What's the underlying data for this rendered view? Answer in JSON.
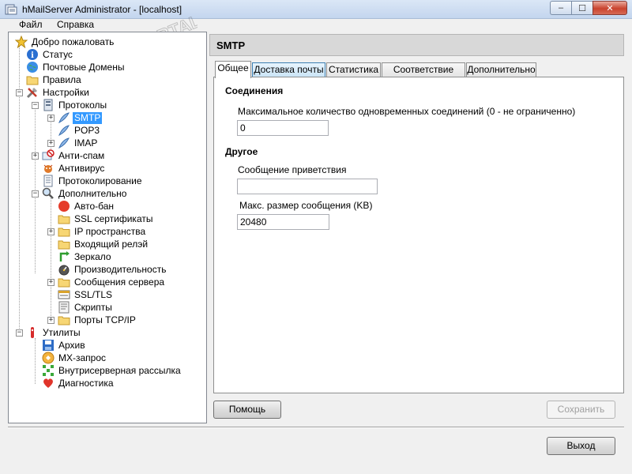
{
  "window": {
    "title": "hMailServer Administrator - [localhost]",
    "minimize": "‒",
    "maximize": "☐",
    "close": "✕"
  },
  "menu": [
    {
      "label": "Файл"
    },
    {
      "label": "Справка"
    }
  ],
  "tree": [
    {
      "label": "Добро пожаловать",
      "icon": "star-icon"
    },
    {
      "label": "Статус",
      "icon": "info-icon"
    },
    {
      "label": "Почтовые Домены",
      "icon": "globe-icon"
    },
    {
      "label": "Правила",
      "icon": "folder-icon"
    },
    {
      "label": "Настройки",
      "icon": "tools-icon"
    },
    {
      "label": "Протоколы",
      "icon": "server-icon"
    },
    {
      "label": "SMTP",
      "icon": "feather-icon"
    },
    {
      "label": "POP3",
      "icon": "feather-icon"
    },
    {
      "label": "IMAP",
      "icon": "feather-icon"
    },
    {
      "label": "Анти-спам",
      "icon": "antispam-icon"
    },
    {
      "label": "Антивирус",
      "icon": "antivirus-icon"
    },
    {
      "label": "Протоколирование",
      "icon": "log-icon"
    },
    {
      "label": "Дополнительно",
      "icon": "magnifier-icon"
    },
    {
      "label": "Авто-бан",
      "icon": "red-circle-icon"
    },
    {
      "label": "SSL сертификаты",
      "icon": "folder-icon"
    },
    {
      "label": "IP пространства",
      "icon": "folder-icon"
    },
    {
      "label": "Входящий релэй",
      "icon": "folder-icon"
    },
    {
      "label": "Зеркало",
      "icon": "mirror-icon"
    },
    {
      "label": "Производительность",
      "icon": "gauge-icon"
    },
    {
      "label": "Сообщения сервера",
      "icon": "folder-icon"
    },
    {
      "label": "SSL/TLS",
      "icon": "ssl-icon"
    },
    {
      "label": "Скрипты",
      "icon": "script-icon"
    },
    {
      "label": "Порты TCP/IP",
      "icon": "folder-icon"
    },
    {
      "label": "Утилиты",
      "icon": "utilities-icon"
    },
    {
      "label": "Архив",
      "icon": "floppy-icon"
    },
    {
      "label": "MX-запрос",
      "icon": "mx-icon"
    },
    {
      "label": "Внутрисерверная рассылка",
      "icon": "dots-icon"
    },
    {
      "label": "Диагностика",
      "icon": "heart-icon"
    }
  ],
  "panel": {
    "title": "SMTP",
    "tabs": [
      {
        "label": "Общее"
      },
      {
        "label": "Доставка почты"
      },
      {
        "label": "Статистика"
      },
      {
        "label": "Соответствие RFC"
      },
      {
        "label": "Дополнительно"
      }
    ],
    "connections": {
      "title": "Соединения",
      "max_label": "Максимальное количество одновременных соединений (0 - не ограниченно)",
      "max_value": "0"
    },
    "other": {
      "title": "Другое",
      "welcome_label": "Сообщение приветствия",
      "welcome_value": "",
      "maxsize_label": "Макс. размер сообщения (KB)",
      "maxsize_value": "20480"
    }
  },
  "buttons": {
    "help": "Помощь",
    "save": "Сохранить",
    "exit": "Выход"
  },
  "watermark": {
    "text": "PORTAL"
  }
}
